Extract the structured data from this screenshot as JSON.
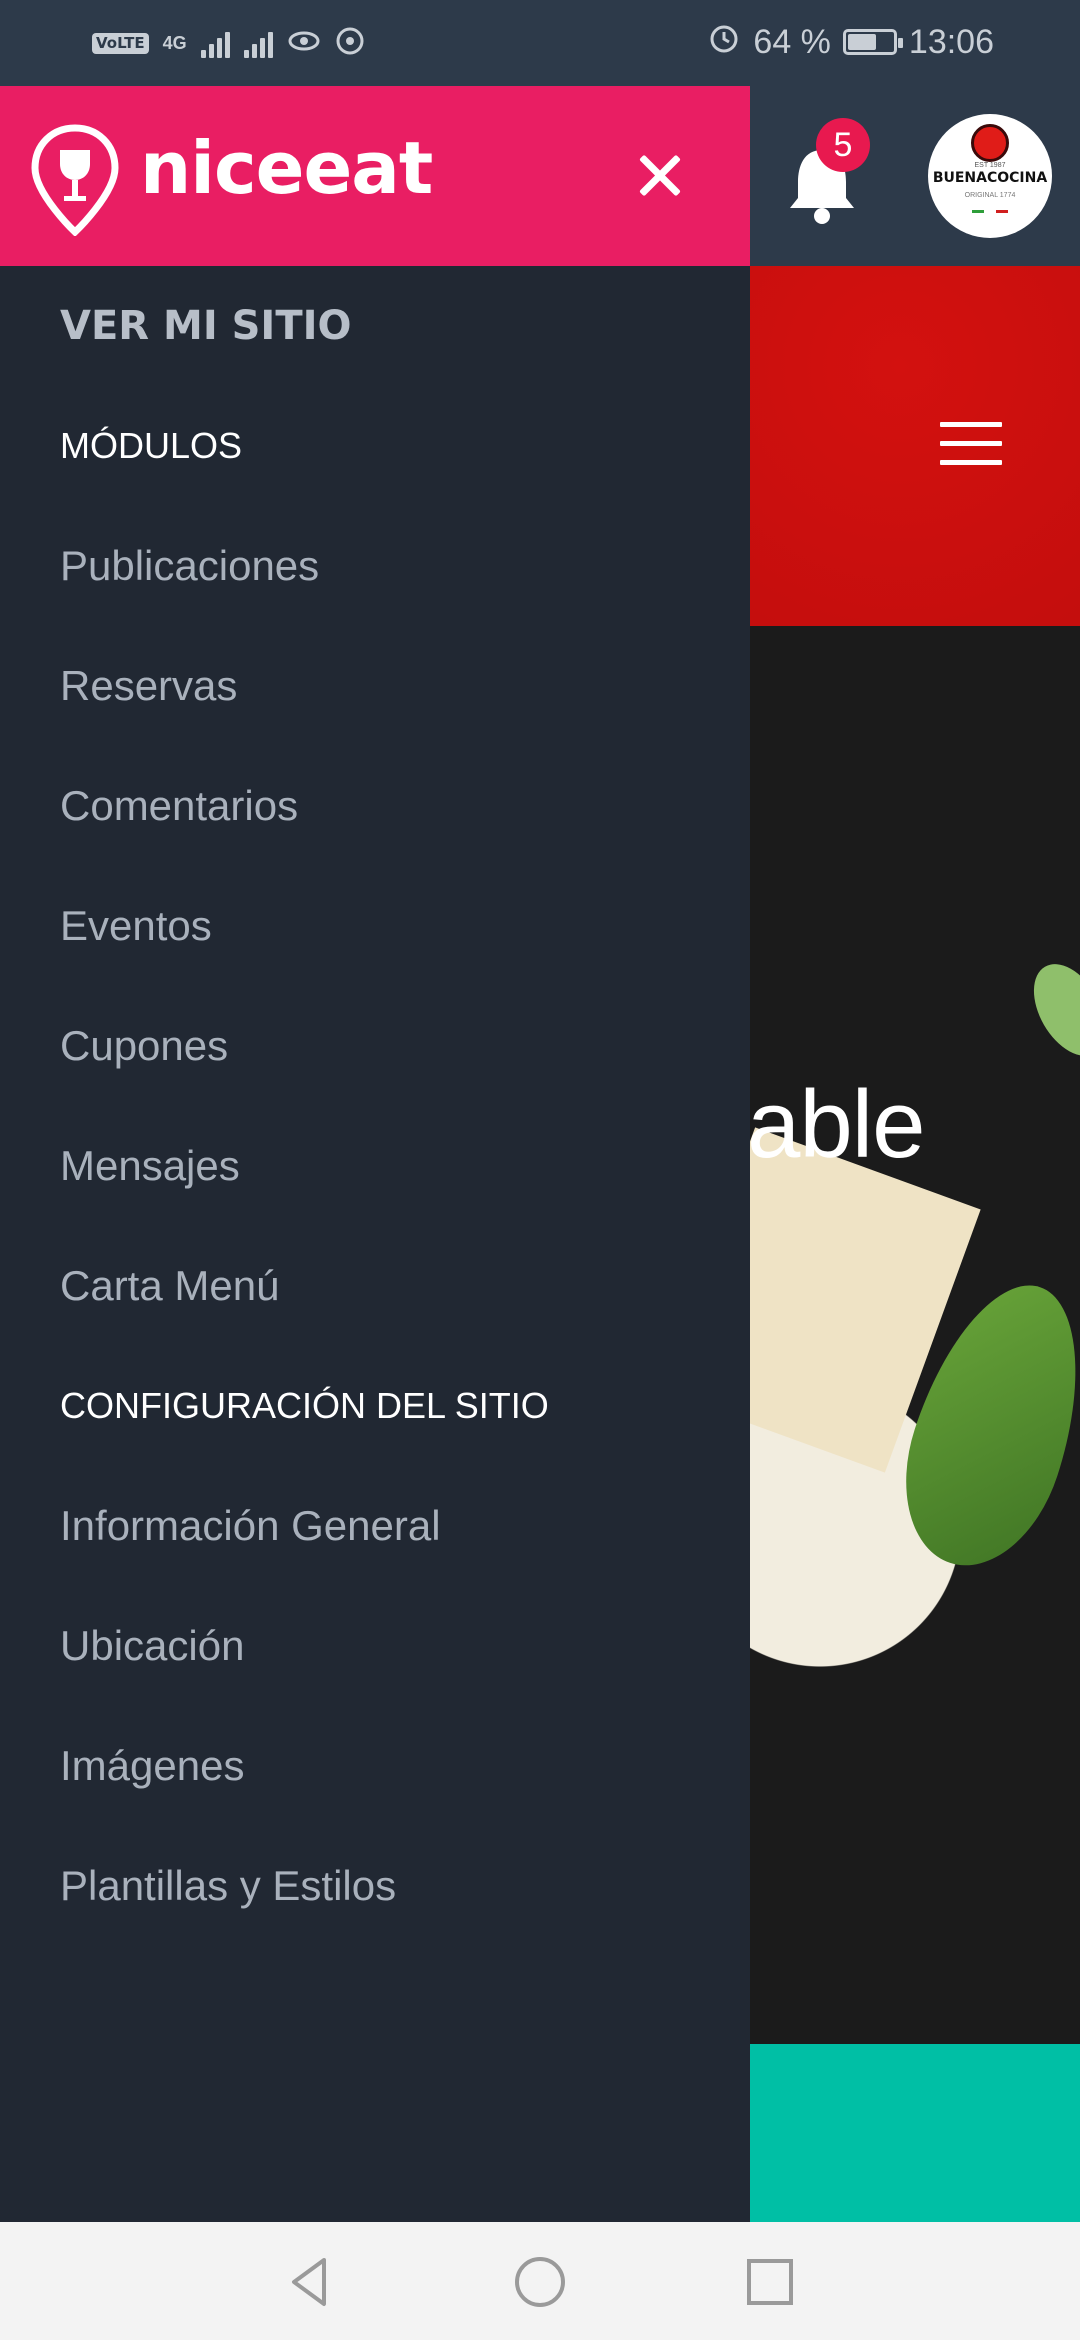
{
  "status_bar": {
    "volte": "VoLTE",
    "network": "4G",
    "alarm_icon": "alarm-icon",
    "battery_percent": "64 %",
    "battery_level": 0.64,
    "time": "13:06"
  },
  "app_bar": {
    "notifications_count": "5",
    "avatar": {
      "est": "EST 1987",
      "brand": "BUENACOCINA",
      "sub": "ORIGINAL 1774"
    }
  },
  "hero": {
    "text_fragment": "zable"
  },
  "drawer": {
    "logo_text": "niceeat",
    "close_icon": "close-icon",
    "items": [
      {
        "label": "VER MI SITIO",
        "kind": "site"
      },
      {
        "label": "MÓDULOS",
        "kind": "section"
      },
      {
        "label": "Publicaciones",
        "kind": "link"
      },
      {
        "label": "Reservas",
        "kind": "link"
      },
      {
        "label": "Comentarios",
        "kind": "link"
      },
      {
        "label": "Eventos",
        "kind": "link"
      },
      {
        "label": "Cupones",
        "kind": "link"
      },
      {
        "label": "Mensajes",
        "kind": "link"
      },
      {
        "label": "Carta Menú",
        "kind": "link"
      },
      {
        "label": "CONFIGURACIÓN DEL SITIO",
        "kind": "section"
      },
      {
        "label": "Información General",
        "kind": "link"
      },
      {
        "label": "Ubicación",
        "kind": "link"
      },
      {
        "label": "Imágenes",
        "kind": "link"
      },
      {
        "label": "Plantillas y Estilos",
        "kind": "link"
      }
    ]
  },
  "colors": {
    "brand": "#e91e63",
    "drawer_bg": "#212833",
    "teal": "#00bfa5"
  }
}
